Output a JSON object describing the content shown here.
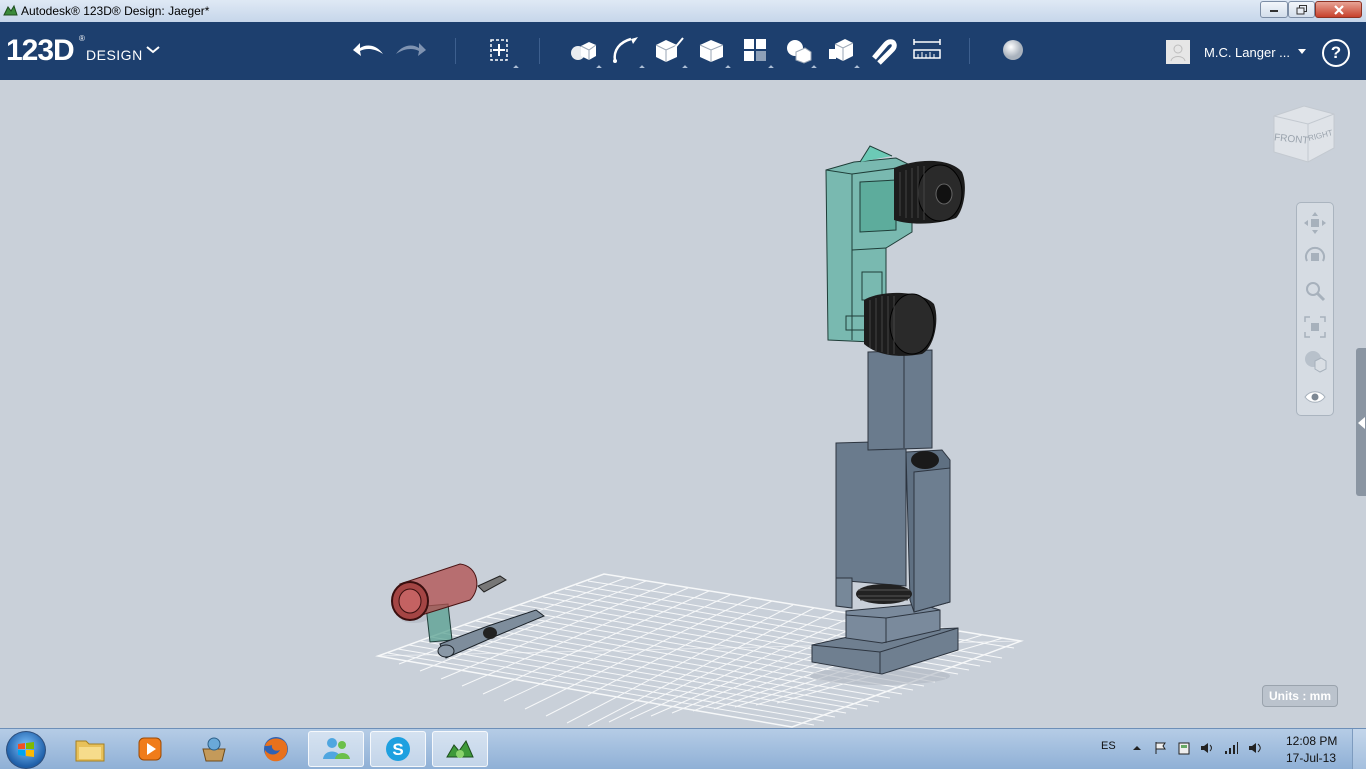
{
  "window": {
    "title": "Autodesk® 123D® Design: Jaeger*",
    "controls": [
      "minimize-icon",
      "maximize-icon",
      "close-icon"
    ]
  },
  "app": {
    "logo_main": "123D",
    "logo_sup": "®",
    "logo_sub": "DESIGN"
  },
  "toolbar": {
    "tools": [
      {
        "name": "undo",
        "icon": "undo-arrow-icon"
      },
      {
        "name": "redo",
        "icon": "redo-arrow-icon"
      },
      {
        "name": "transform",
        "icon": "transform-move-icon"
      },
      {
        "name": "primitives",
        "icon": "primitives-box-sphere-icon"
      },
      {
        "name": "sketch",
        "icon": "sketch-curve-icon"
      },
      {
        "name": "construct",
        "icon": "construct-extrude-icon"
      },
      {
        "name": "modify",
        "icon": "modify-box-icon"
      },
      {
        "name": "pattern",
        "icon": "pattern-grid-icon"
      },
      {
        "name": "grouping",
        "icon": "grouping-shapes-icon"
      },
      {
        "name": "combine",
        "icon": "combine-merge-icon"
      },
      {
        "name": "snap",
        "icon": "snap-magnet-icon"
      },
      {
        "name": "measure",
        "icon": "measure-ruler-icon"
      },
      {
        "name": "material",
        "icon": "material-sphere-icon"
      }
    ]
  },
  "user": {
    "name": "M.C. Langer ...",
    "help": "?"
  },
  "viewcube": {
    "front": "FRONT",
    "right": "RIGHT"
  },
  "navigation": [
    "pan-icon",
    "orbit-icon",
    "zoom-icon",
    "fit-icon",
    "view-mode-icon",
    "visibility-eye-icon"
  ],
  "status": {
    "units": "Units : mm"
  },
  "taskbar": {
    "apps": [
      "file-explorer-icon",
      "media-player-icon",
      "downloads-basket-icon",
      "firefox-icon",
      "windows-live-messenger-icon",
      "skype-icon",
      "123d-design-icon"
    ],
    "language": "ES",
    "time": "12:08 PM",
    "date": "17-Jul-13"
  },
  "colors": {
    "toolbar_bg": "#1d3f6e",
    "viewport_bg": "#c9d0d9",
    "part_teal": "#5fb4a4",
    "part_gray": "#697a8c",
    "part_red": "#b04d4c"
  }
}
